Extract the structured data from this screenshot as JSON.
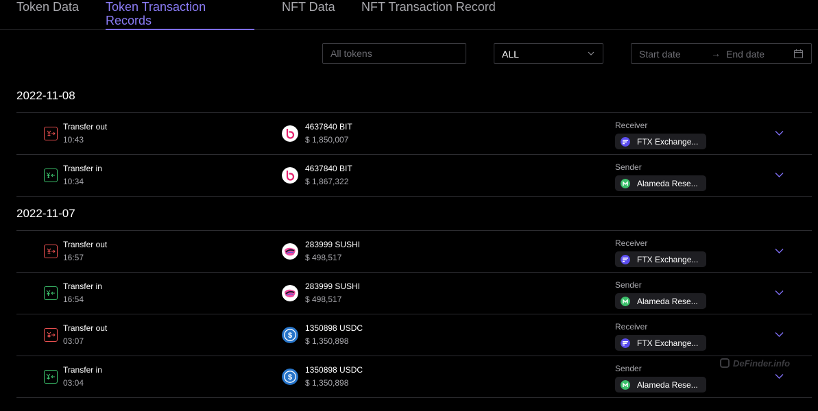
{
  "tabs": [
    {
      "label": "Token Data"
    },
    {
      "label": "Token Transaction Records"
    },
    {
      "label": "NFT Data"
    },
    {
      "label": "NFT Transaction Record"
    }
  ],
  "filters": {
    "token_placeholder": "All tokens",
    "type_select": "ALL",
    "start_date_placeholder": "Start date",
    "end_date_placeholder": "End date",
    "date_separator": "→"
  },
  "colors": {
    "accent": "#7d6df2",
    "transfer_out": "#e84f4f",
    "transfer_in": "#3bbf6a",
    "bit_brand": "#e6226e",
    "sushi_brand": "#f24c9e",
    "usdc_brand": "#2775ca",
    "ftx_party": "#5b4df0",
    "alameda_party": "#3bbf6a"
  },
  "groups": [
    {
      "date": "2022-11-08",
      "rows": [
        {
          "type": "Transfer out",
          "time": "10:43",
          "amount": "4637840 BIT",
          "value": "$ 1,850,007",
          "party_label": "Receiver",
          "party": "FTX Exchange...",
          "token_icon": "bit-logo-icon",
          "direction_icon": "transfer-out-icon"
        },
        {
          "type": "Transfer in",
          "time": "10:34",
          "amount": "4637840 BIT",
          "value": "$ 1,867,322",
          "party_label": "Sender",
          "party": "Alameda Rese...",
          "token_icon": "bit-logo-icon",
          "direction_icon": "transfer-in-icon"
        }
      ]
    },
    {
      "date": "2022-11-07",
      "rows": [
        {
          "type": "Transfer out",
          "time": "16:57",
          "amount": "283999 SUSHI",
          "value": "$ 498,517",
          "party_label": "Receiver",
          "party": "FTX Exchange...",
          "token_icon": "sushi-logo-icon",
          "direction_icon": "transfer-out-icon"
        },
        {
          "type": "Transfer in",
          "time": "16:54",
          "amount": "283999 SUSHI",
          "value": "$ 498,517",
          "party_label": "Sender",
          "party": "Alameda Rese...",
          "token_icon": "sushi-logo-icon",
          "direction_icon": "transfer-in-icon"
        },
        {
          "type": "Transfer out",
          "time": "03:07",
          "amount": "1350898 USDC",
          "value": "$ 1,350,898",
          "party_label": "Receiver",
          "party": "FTX Exchange...",
          "token_icon": "usdc-logo-icon",
          "direction_icon": "transfer-out-icon"
        },
        {
          "type": "Transfer in",
          "time": "03:04",
          "amount": "1350898 USDC",
          "value": "$ 1,350,898",
          "party_label": "Sender",
          "party": "Alameda Rese...",
          "token_icon": "usdc-logo-icon",
          "direction_icon": "transfer-in-icon"
        }
      ]
    }
  ],
  "watermark": "DeFinder.info"
}
